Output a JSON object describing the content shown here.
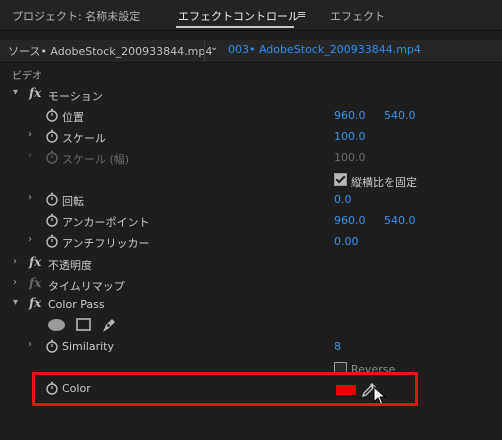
{
  "tabs": {
    "project": "プロジェクト: 名称未設定",
    "effect_controls": "エフェクトコントロール",
    "menu_symbol": "≡",
    "effects": "エフェクト"
  },
  "source_bar": {
    "source": "ソース• AdobeStock_200933844.mp4",
    "sequence": "003• AdobeStock_200933844.mp4",
    "caret": "⌄"
  },
  "video_header": "ビデオ",
  "motion": {
    "label": "モーション",
    "position": {
      "label": "位置",
      "x": "960.0",
      "y": "540.0"
    },
    "scale": {
      "label": "スケール",
      "value": "100.0"
    },
    "scale_width": {
      "label": "スケール (幅)",
      "value": "100.0"
    },
    "uniform_scale": {
      "label": "縦横比を固定",
      "checked": true
    },
    "rotation": {
      "label": "回転",
      "value": "0.0"
    },
    "anchor": {
      "label": "アンカーポイント",
      "x": "960.0",
      "y": "540.0"
    },
    "antiflicker": {
      "label": "アンチフリッカー",
      "value": "0.00"
    }
  },
  "opacity": {
    "label": "不透明度"
  },
  "time_remap": {
    "label": "タイムリマップ"
  },
  "color_pass": {
    "label": "Color Pass",
    "similarity": {
      "label": "Similarity",
      "value": "8"
    },
    "reverse": {
      "label": "Reverse",
      "checked": false
    },
    "color": {
      "label": "Color",
      "swatch": "#e00000"
    }
  },
  "icons": {
    "twirl_open": "▾",
    "twirl_closed": "›"
  },
  "colors": {
    "accent_blue": "#3a90e6",
    "highlight_red": "#e3151b"
  }
}
